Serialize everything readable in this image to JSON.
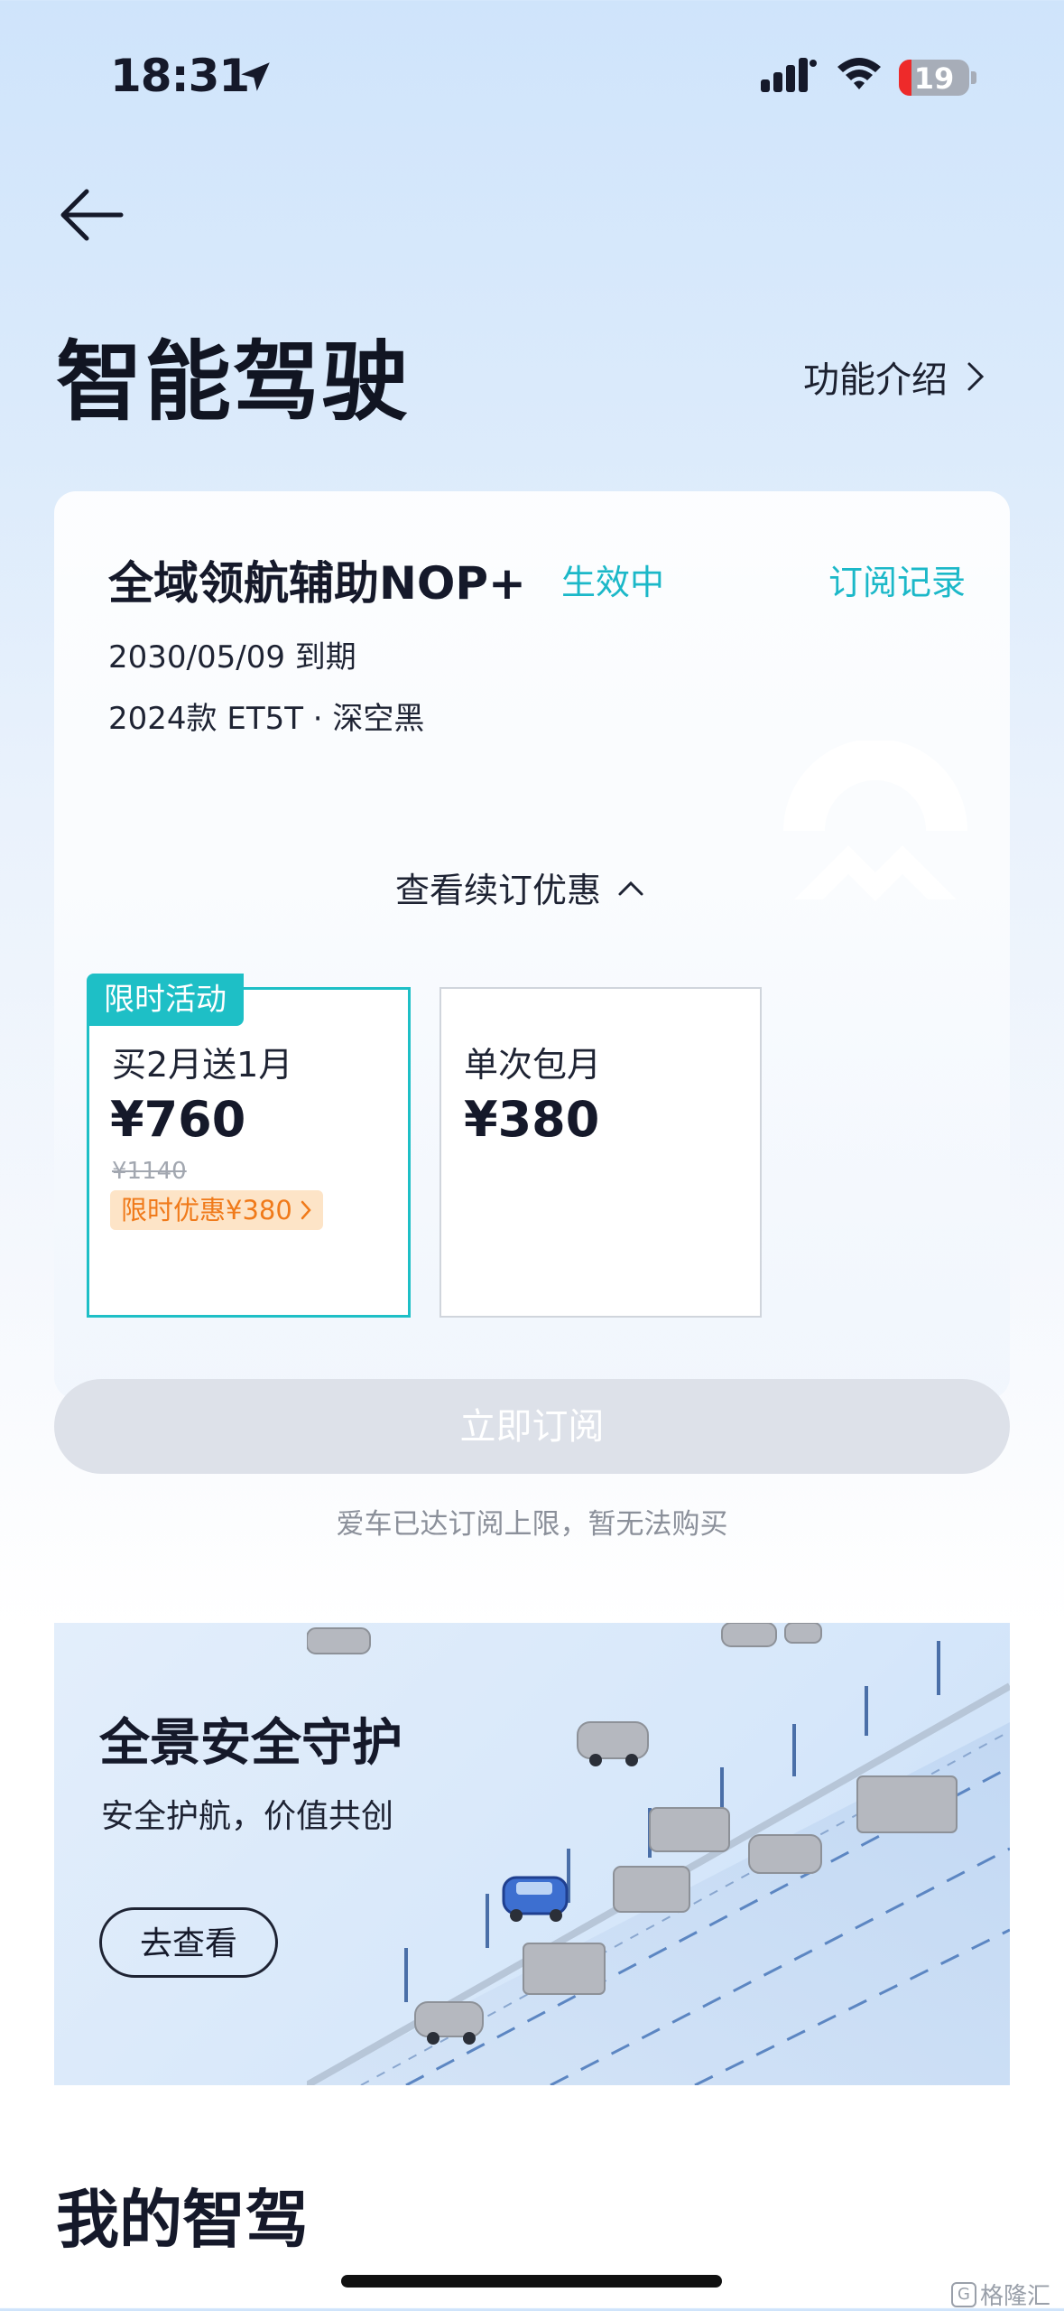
{
  "status_bar": {
    "time": "18:31",
    "battery": "19"
  },
  "header": {
    "title": "智能驾驶",
    "feature_link": "功能介绍"
  },
  "subscription": {
    "name": "全域领航辅助NOP+",
    "status": "生效中",
    "record_link": "订阅记录",
    "expire": "2030/05/09 到期",
    "car": "2024款 ET5T · 深空黑",
    "renew_toggle": "查看续订优惠"
  },
  "plans": [
    {
      "tag": "限时活动",
      "name": "买2月送1月",
      "price": "¥760",
      "original_price": "¥1140",
      "discount": "限时优惠¥380"
    },
    {
      "name": "单次包月",
      "price": "¥380"
    }
  ],
  "subscribe_button": "立即订阅",
  "limit_note": "爱车已达订阅上限，暂无法购买",
  "safety": {
    "title": "全景安全守护",
    "subtitle": "安全护航，价值共创",
    "button": "去查看"
  },
  "my_drive_title": "我的智驾",
  "watermark": "格隆汇",
  "colors": {
    "accent": "#1ebfc6",
    "discount": "#f07a1a",
    "disabled_button": "#dde1e9"
  }
}
